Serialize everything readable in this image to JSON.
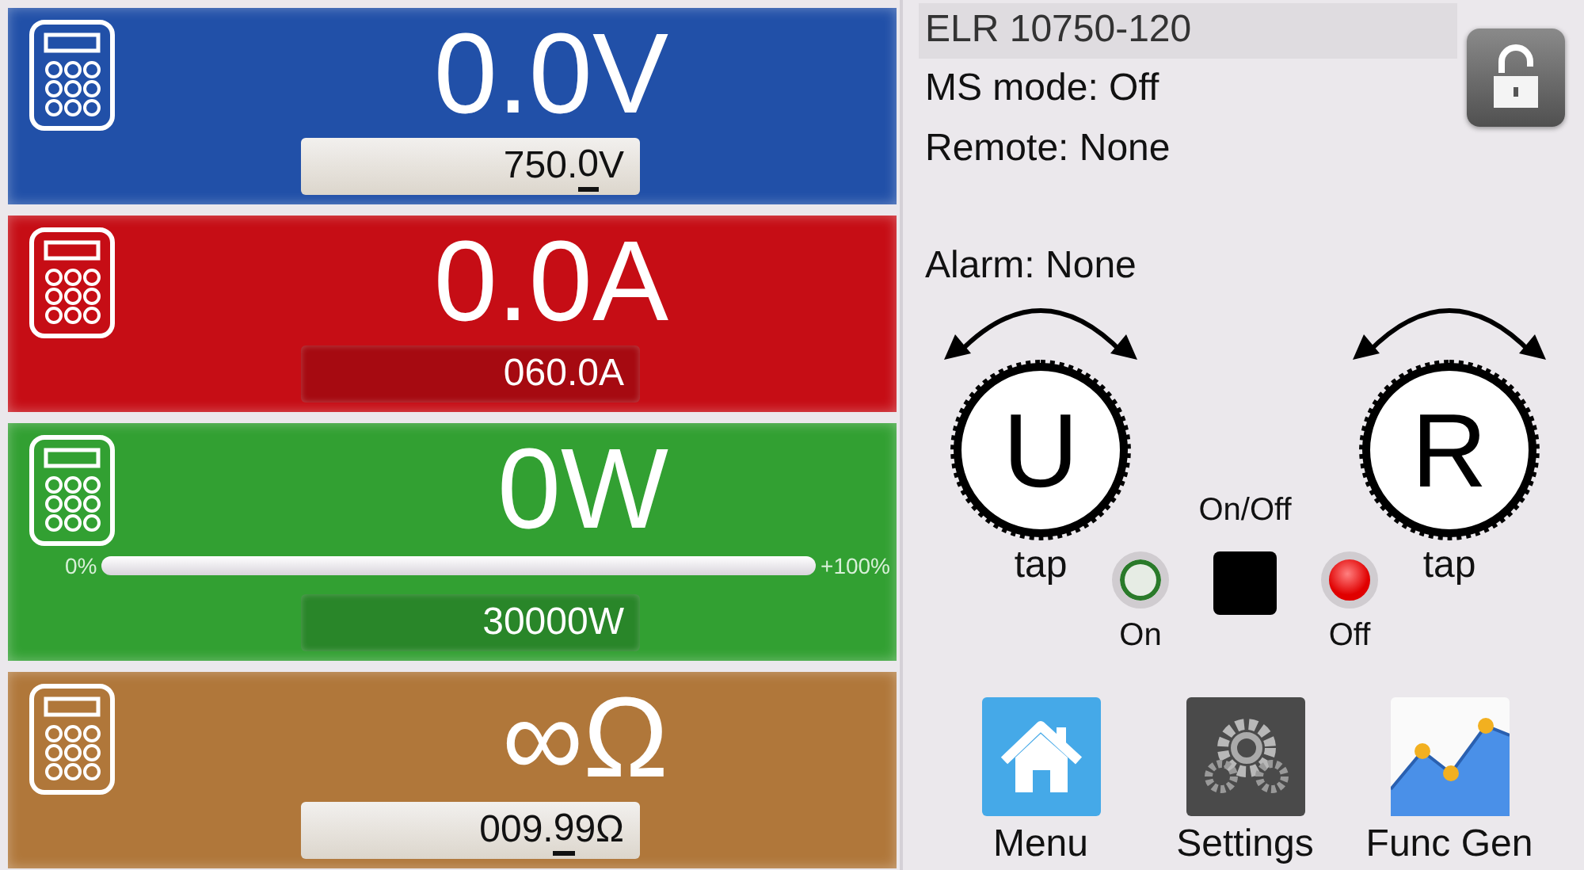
{
  "panels": [
    {
      "color": "#2150a8",
      "reading": "0.0V",
      "setpoint_selected": true,
      "setpoint_parts": [
        {
          "text": "750.",
          "cursor": false
        },
        {
          "text": "0",
          "cursor": true
        },
        {
          "text": "V",
          "cursor": false
        }
      ]
    },
    {
      "color": "#c60d15",
      "reading": "0.0A",
      "setpoint_selected": false,
      "setpoint_parts": [
        {
          "text": "060.0A",
          "cursor": false
        }
      ]
    },
    {
      "color": "#32a032",
      "reading": "0W",
      "setpoint_selected": false,
      "setpoint_parts": [
        {
          "text": "30000W",
          "cursor": false
        }
      ],
      "bar": {
        "start_label": "0%",
        "end_label": "+100%"
      }
    },
    {
      "color": "#b0773a",
      "reading": "∞Ω",
      "setpoint_selected": true,
      "setpoint_parts": [
        {
          "text": "009.",
          "cursor": false
        },
        {
          "text": "9",
          "cursor": true
        },
        {
          "text": "9Ω",
          "cursor": false
        }
      ]
    }
  ],
  "device": {
    "model": "ELR 10750-120",
    "status_lines": [
      "MS mode: Off",
      "Remote: None"
    ],
    "alarm": "Alarm: None"
  },
  "lock": {
    "locked": false
  },
  "knobs": [
    {
      "letter": "U",
      "hint": "tap"
    },
    {
      "letter": "R",
      "hint": "tap"
    }
  ],
  "output": {
    "label": "On/Off",
    "indicators": [
      {
        "kind": "on",
        "label": "On",
        "lit": false
      },
      {
        "kind": "off",
        "label": "Off",
        "lit": true
      }
    ]
  },
  "buttons": [
    {
      "kind": "home",
      "label": "Menu"
    },
    {
      "kind": "settings",
      "label": "Settings"
    },
    {
      "kind": "chart",
      "label": "Func Gen"
    }
  ]
}
